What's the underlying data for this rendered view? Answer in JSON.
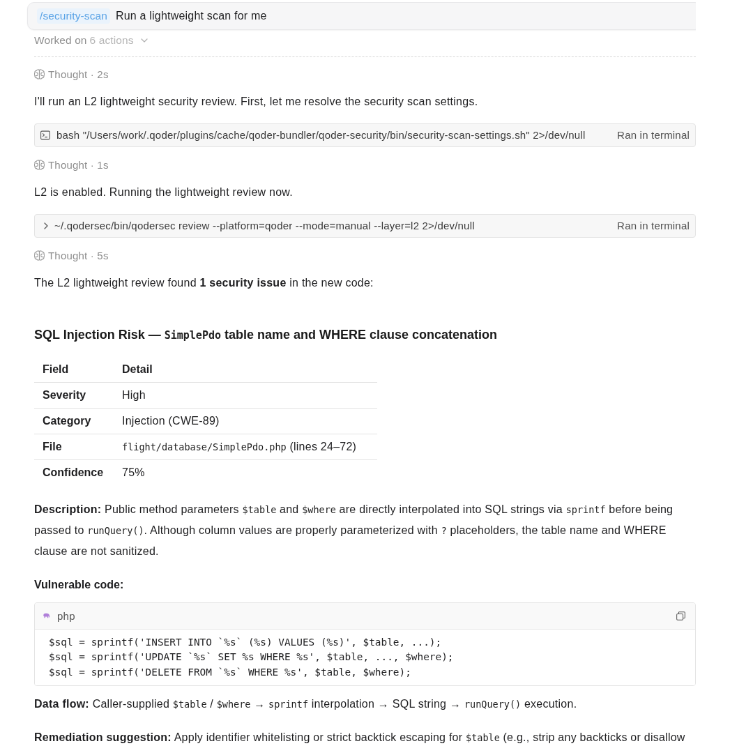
{
  "prompt": {
    "command": "/security-scan",
    "text": "Run a lightweight scan for me"
  },
  "summary": {
    "label": "Worked on",
    "count": "6 actions"
  },
  "steps": [
    {
      "kind": "thought",
      "label": "Thought · 2s"
    },
    {
      "kind": "message",
      "text": "I'll run an L2 lightweight security review. First, let me resolve the security scan settings."
    },
    {
      "kind": "terminal_command",
      "command": "bash \"/Users/work/.qoder/plugins/cache/qoder-bundler/qoder-security/bin/security-scan-settings.sh\" 2>/dev/null",
      "status": "Ran in terminal"
    },
    {
      "kind": "thought",
      "label": "Thought · 1s"
    },
    {
      "kind": "message",
      "text": "L2 is enabled. Running the lightweight review now."
    },
    {
      "kind": "collapsible_command",
      "command": "~/.qodersec/bin/qodersec review --platform=qoder --mode=manual --layer=l2 2>/dev/null",
      "status": "Ran in terminal"
    },
    {
      "kind": "thought",
      "label": "Thought · 5s"
    },
    {
      "kind": "message",
      "text": "The L2 lightweight review found **1 security issue** in the new code:"
    }
  ],
  "report": {
    "heading": [
      {
        "kind": "text",
        "text": "SQL Injection Risk — "
      },
      {
        "kind": "code",
        "text": "SimplePdo"
      },
      {
        "kind": "text",
        "text": " table name and WHERE clause concatenation"
      }
    ],
    "table": {
      "columns": [
        "Field",
        "Detail"
      ],
      "rows": [
        {
          "field": "Severity",
          "detail": [
            {
              "kind": "text",
              "text": "High"
            }
          ]
        },
        {
          "field": "Category",
          "detail": [
            {
              "kind": "text",
              "text": "Injection (CWE-89)"
            }
          ]
        },
        {
          "field": "File",
          "detail": [
            {
              "kind": "code",
              "text": "flight/database/SimplePdo.php"
            },
            {
              "kind": "text",
              "text": " (lines 24–72)"
            }
          ]
        },
        {
          "field": "Confidence",
          "detail": [
            {
              "kind": "text",
              "text": "75%"
            }
          ]
        }
      ]
    },
    "description": [
      {
        "kind": "text",
        "text": "**Description:** Public method parameters "
      },
      {
        "kind": "code",
        "text": "$table"
      },
      {
        "kind": "text",
        "text": " and "
      },
      {
        "kind": "code",
        "text": "$where"
      },
      {
        "kind": "text",
        "text": " are directly interpolated into SQL strings via "
      },
      {
        "kind": "code",
        "text": "sprintf"
      },
      {
        "kind": "text",
        "text": " before being passed to "
      },
      {
        "kind": "code",
        "text": "runQuery()"
      },
      {
        "kind": "text",
        "text": ". Although column values are properly parameterized with "
      },
      {
        "kind": "code",
        "text": "?"
      },
      {
        "kind": "text",
        "text": " placeholders, the table name and WHERE clause are not sanitized."
      }
    ],
    "code_label": "Vulnerable code:",
    "code_block": {
      "language": "php",
      "lines": [
        "$sql = sprintf('INSERT INTO `%s` (%s) VALUES (%s)', $table, ...);",
        "$sql = sprintf('UPDATE `%s` SET %s WHERE %s', $table, ..., $where);",
        "$sql = sprintf('DELETE FROM `%s` WHERE %s', $table, $where);"
      ]
    },
    "data_flow": [
      {
        "kind": "text",
        "text": "**Data flow:** Caller-supplied "
      },
      {
        "kind": "code",
        "text": "$table"
      },
      {
        "kind": "text",
        "text": " / "
      },
      {
        "kind": "code",
        "text": "$where"
      },
      {
        "kind": "text",
        "text": " → "
      },
      {
        "kind": "code",
        "text": "sprintf"
      },
      {
        "kind": "text",
        "text": " interpolation → SQL string → "
      },
      {
        "kind": "code",
        "text": "runQuery()"
      },
      {
        "kind": "text",
        "text": " execution."
      }
    ],
    "remediation": [
      {
        "kind": "text",
        "text": "**Remediation suggestion:** Apply identifier whitelisting or strict backtick escaping for "
      },
      {
        "kind": "code",
        "text": "$table"
      },
      {
        "kind": "text",
        "text": " (e.g., strip any backticks or disallow"
      }
    ]
  }
}
